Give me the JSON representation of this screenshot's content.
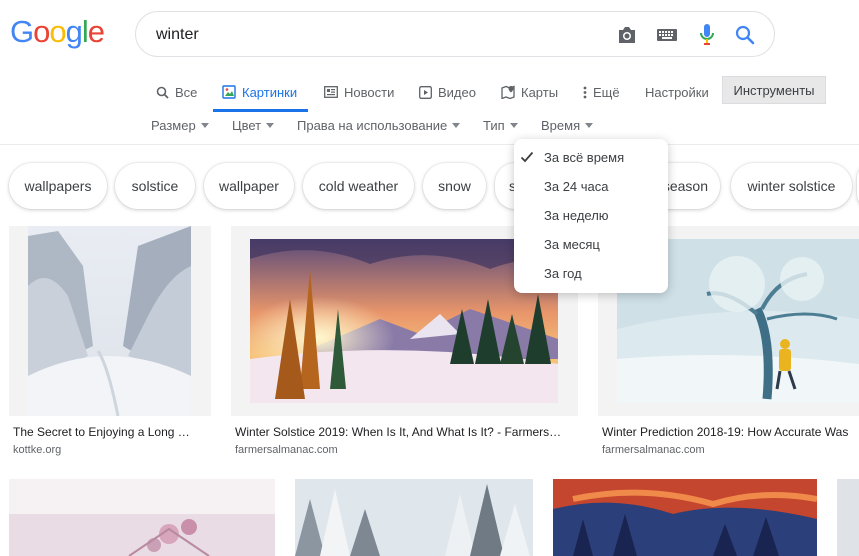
{
  "logo": {
    "letters": [
      "G",
      "o",
      "o",
      "g",
      "l",
      "e"
    ],
    "colors": [
      "#4285F4",
      "#EA4335",
      "#FBBC05",
      "#4285F4",
      "#34A853",
      "#EA4335"
    ]
  },
  "search": {
    "query": "winter",
    "icons": [
      "camera-icon",
      "keyboard-icon",
      "microphone-icon",
      "search-icon"
    ]
  },
  "tabs": {
    "all": "Все",
    "images": "Картинки",
    "news": "Новости",
    "video": "Видео",
    "maps": "Карты",
    "more": "Ещё",
    "settings": "Настройки",
    "tools": "Инструменты",
    "active_color": "#1a73e8"
  },
  "filters": {
    "size": "Размер",
    "color": "Цвет",
    "rights": "Права на использование",
    "type": "Тип",
    "time": "Время"
  },
  "chips": [
    "wallpapers",
    "solstice",
    "wallpaper",
    "cold weather",
    "snow",
    "s",
    "season",
    "winter solstice"
  ],
  "time_menu": {
    "items": [
      "За всё время",
      "За 24 часа",
      "За неделю",
      "За месяц",
      "За год"
    ],
    "selected_index": 0
  },
  "results": [
    {
      "caption": "The Secret to Enjoying a Long …",
      "source": "kottke.org"
    },
    {
      "caption": "Winter Solstice 2019: When Is It, And What Is It? - Farmers…",
      "source": "farmersalmanac.com"
    },
    {
      "caption": "Winter Prediction 2018-19: How Accurate Was",
      "source": "farmersalmanac.com"
    }
  ]
}
